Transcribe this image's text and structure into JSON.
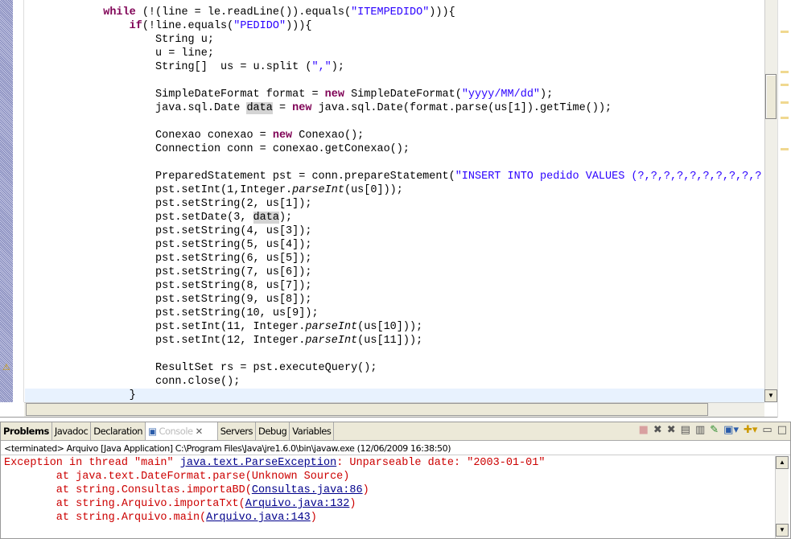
{
  "editor": {
    "lines": [
      [
        [
          "t",
          "            "
        ],
        [
          "kw",
          "while"
        ],
        [
          "t",
          " (!(line = le.readLine()).equals("
        ],
        [
          "str",
          "\"ITEMPEDIDO\""
        ],
        [
          "t",
          "))){"
        ]
      ],
      [
        [
          "t",
          "                "
        ],
        [
          "kw",
          "if"
        ],
        [
          "t",
          "(!line.equals("
        ],
        [
          "str",
          "\"PEDIDO\""
        ],
        [
          "t",
          "))){"
        ]
      ],
      [
        [
          "t",
          "                    String u;"
        ]
      ],
      [
        [
          "t",
          "                    u = line;"
        ]
      ],
      [
        [
          "t",
          "                    String[]  us = u.split ("
        ],
        [
          "str",
          "\",\""
        ],
        [
          "t",
          ");"
        ]
      ],
      [],
      [
        [
          "t",
          "                    SimpleDateFormat format = "
        ],
        [
          "kw",
          "new"
        ],
        [
          "t",
          " SimpleDateFormat("
        ],
        [
          "str",
          "\"yyyy/MM/dd\""
        ],
        [
          "t",
          ");"
        ]
      ],
      [
        [
          "t",
          "                    java.sql.Date "
        ],
        [
          "hl",
          "data"
        ],
        [
          "t",
          " = "
        ],
        [
          "kw",
          "new"
        ],
        [
          "t",
          " java.sql.Date(format.parse(us[1]).getTime());"
        ]
      ],
      [],
      [
        [
          "t",
          "                    Conexao conexao = "
        ],
        [
          "kw",
          "new"
        ],
        [
          "t",
          " Conexao();"
        ]
      ],
      [
        [
          "t",
          "                    Connection conn = conexao.getConexao();"
        ]
      ],
      [],
      [
        [
          "t",
          "                    PreparedStatement pst = conn.prepareStatement("
        ],
        [
          "str",
          "\"INSERT INTO pedido VALUES (?,?,?,?,?,?,?,?,?,?"
        ]
      ],
      [
        [
          "t",
          "                    pst.setInt(1,Integer."
        ],
        [
          "it",
          "parseInt"
        ],
        [
          "t",
          "(us[0]));"
        ]
      ],
      [
        [
          "t",
          "                    pst.setString(2, us[1]);"
        ]
      ],
      [
        [
          "t",
          "                    pst.setDate(3, "
        ],
        [
          "hl",
          "data"
        ],
        [
          "t",
          ");"
        ]
      ],
      [
        [
          "t",
          "                    pst.setString(4, us[3]);"
        ]
      ],
      [
        [
          "t",
          "                    pst.setString(5, us[4]);"
        ]
      ],
      [
        [
          "t",
          "                    pst.setString(6, us[5]);"
        ]
      ],
      [
        [
          "t",
          "                    pst.setString(7, us[6]);"
        ]
      ],
      [
        [
          "t",
          "                    pst.setString(8, us[7]);"
        ]
      ],
      [
        [
          "t",
          "                    pst.setString(9, us[8]);"
        ]
      ],
      [
        [
          "t",
          "                    pst.setString(10, us[9]);"
        ]
      ],
      [
        [
          "t",
          "                    pst.setInt(11, Integer."
        ],
        [
          "it",
          "parseInt"
        ],
        [
          "t",
          "(us[10]));"
        ]
      ],
      [
        [
          "t",
          "                    pst.setInt(12, Integer."
        ],
        [
          "it",
          "parseInt"
        ],
        [
          "t",
          "(us[11]));"
        ]
      ],
      [],
      [
        [
          "t",
          "                    ResultSet rs = pst.executeQuery();"
        ]
      ],
      [
        [
          "t",
          "                    conn.close();"
        ]
      ],
      [
        [
          "t",
          "                }"
        ]
      ]
    ],
    "current_line": 28
  },
  "views": {
    "tabs": [
      "Problems",
      "Javadoc",
      "Declaration",
      "Console",
      "Servers",
      "Debug",
      "Variables"
    ],
    "status": "<terminated> Arquivo [Java Application] C:\\Program Files\\Java\\jre1.6.0\\bin\\javaw.exe (12/06/2009 16:38:50)",
    "console": [
      [
        [
          "e",
          "Exception in thread \"main\" "
        ],
        [
          "l",
          "java.text.ParseException"
        ],
        [
          "e",
          ": Unparseable date: \"2003-01-01\""
        ]
      ],
      [
        [
          "e",
          "        at java.text.DateFormat.parse(Unknown Source)"
        ]
      ],
      [
        [
          "e",
          "        at string.Consultas.importaBD("
        ],
        [
          "l",
          "Consultas.java:86"
        ],
        [
          "e",
          ")"
        ]
      ],
      [
        [
          "e",
          "        at string.Arquivo.importaTxt("
        ],
        [
          "l",
          "Arquivo.java:132"
        ],
        [
          "e",
          ")"
        ]
      ],
      [
        [
          "e",
          "        at string.Arquivo.main("
        ],
        [
          "l",
          "Arquivo.java:143"
        ],
        [
          "e",
          ")"
        ]
      ]
    ]
  }
}
